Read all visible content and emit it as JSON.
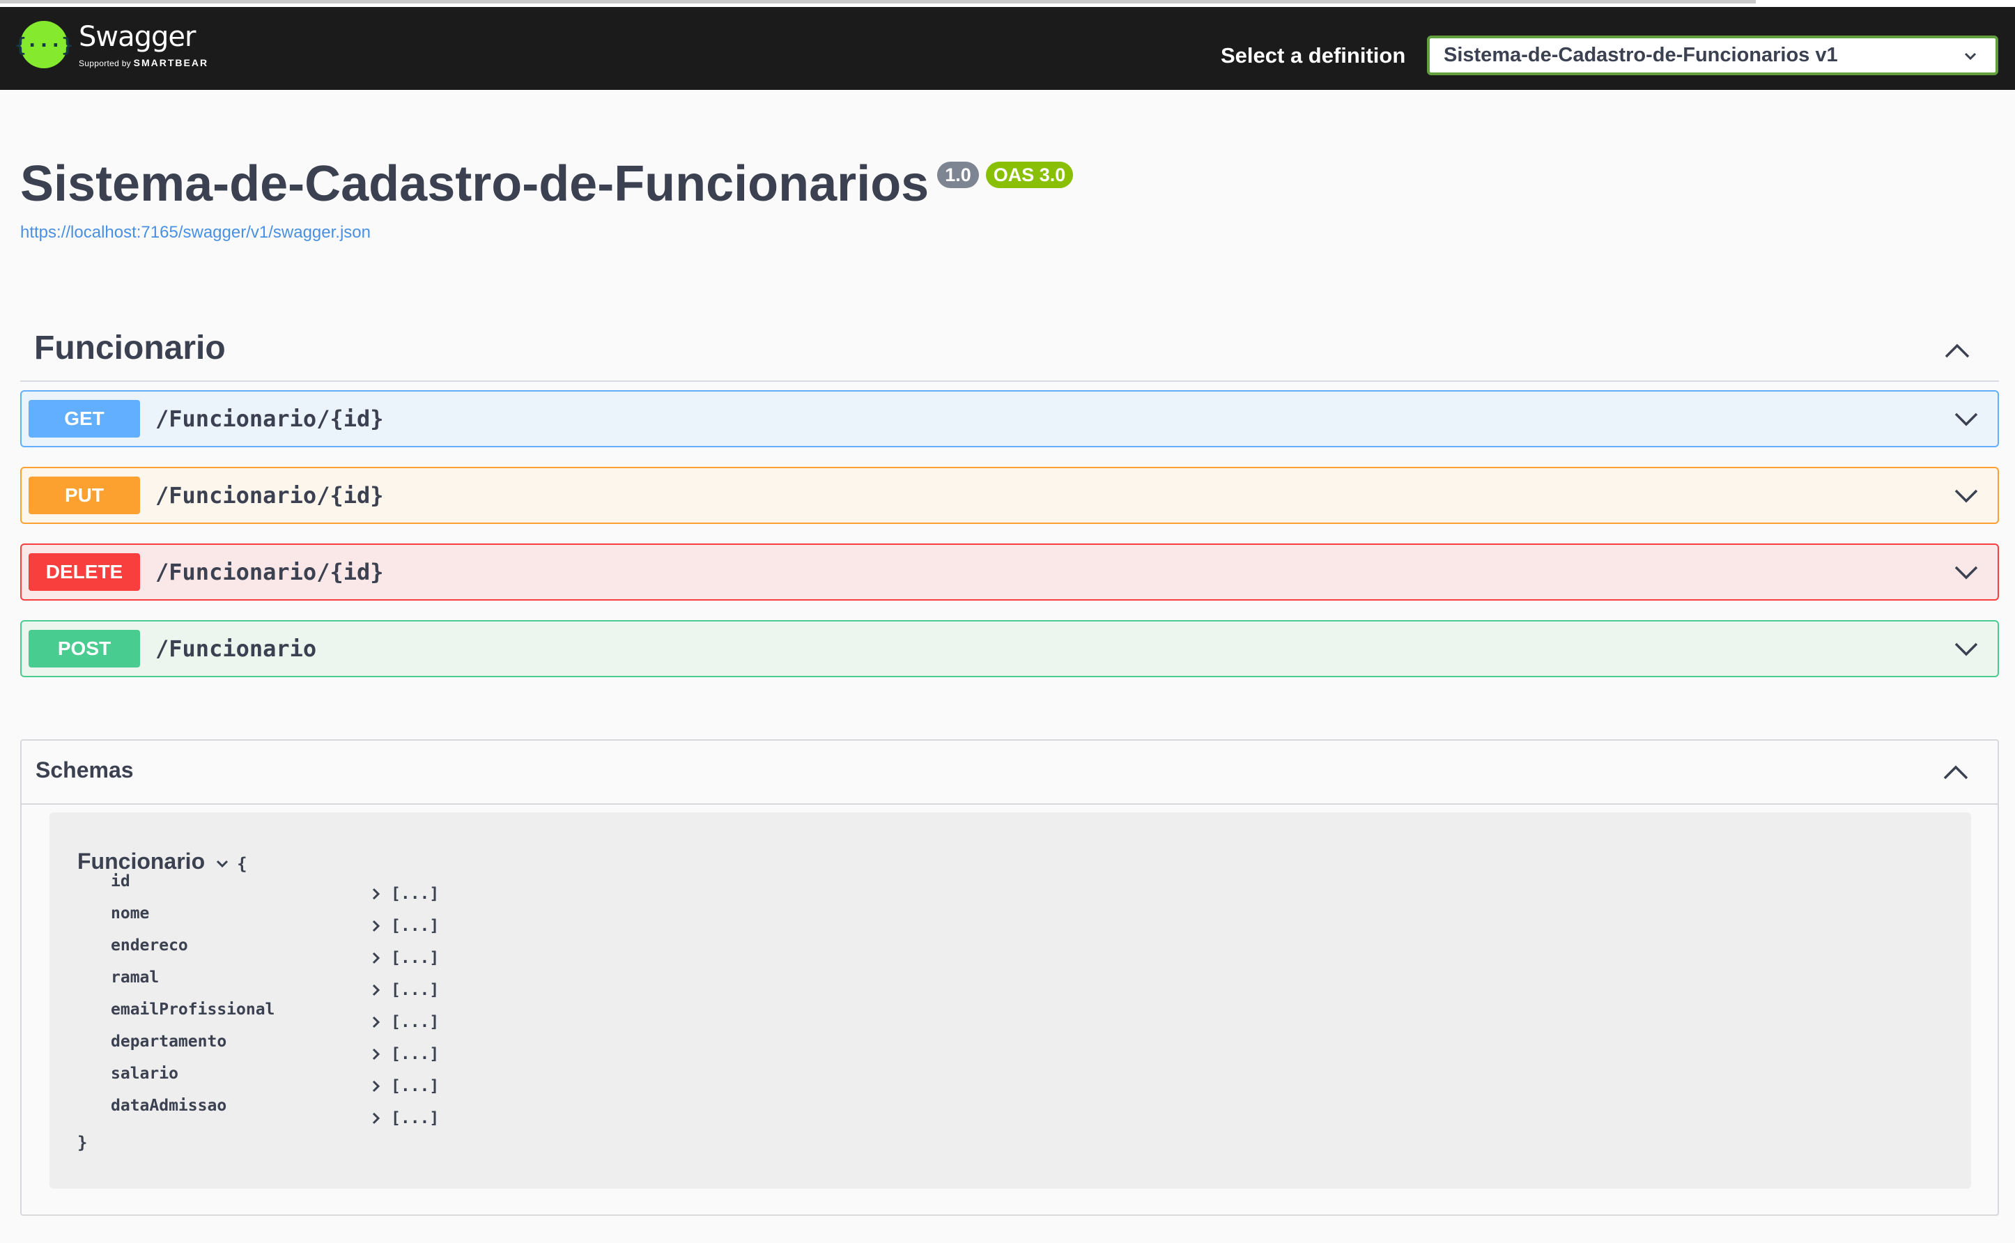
{
  "header": {
    "logo_word": "Swagger",
    "logo_supported": "Supported by",
    "logo_brand": "SMARTBEAR",
    "definition_label": "Select a definition",
    "definition_selected": "Sistema-de-Cadastro-de-Funcionarios v1"
  },
  "info": {
    "title": "Sistema-de-Cadastro-de-Funcionarios",
    "version_badge": "1.0",
    "oas_badge": "OAS 3.0",
    "json_link": "https://localhost:7165/swagger/v1/swagger.json"
  },
  "tag": {
    "name": "Funcionario",
    "operations": [
      {
        "method": "GET",
        "path": "/Funcionario/{id}"
      },
      {
        "method": "PUT",
        "path": "/Funcionario/{id}"
      },
      {
        "method": "DELETE",
        "path": "/Funcionario/{id}"
      },
      {
        "method": "POST",
        "path": "/Funcionario"
      }
    ]
  },
  "schemas": {
    "title": "Schemas",
    "model_name": "Funcionario",
    "open_brace": "{",
    "close_brace": "}",
    "properties": [
      {
        "name": "id",
        "value": "[...]"
      },
      {
        "name": "nome",
        "value": "[...]"
      },
      {
        "name": "endereco",
        "value": "[...]"
      },
      {
        "name": "ramal",
        "value": "[...]"
      },
      {
        "name": "emailProfissional",
        "value": "[...]"
      },
      {
        "name": "departamento",
        "value": "[...]"
      },
      {
        "name": "salario",
        "value": "[...]"
      },
      {
        "name": "dataAdmissao",
        "value": "[...]"
      }
    ]
  },
  "colors": {
    "get": "#61affe",
    "put": "#fca130",
    "delete": "#f93e3e",
    "post": "#49cc90",
    "logo_green": "#85ea2d",
    "topbar": "#1b1b1b"
  },
  "icons": {
    "logo": "swagger-logo-icon",
    "select_arrow": "chevron-down-icon",
    "section_toggle": "chevron-up-icon",
    "op_toggle": "chevron-down-icon",
    "property_expand": "chevron-right-icon"
  }
}
